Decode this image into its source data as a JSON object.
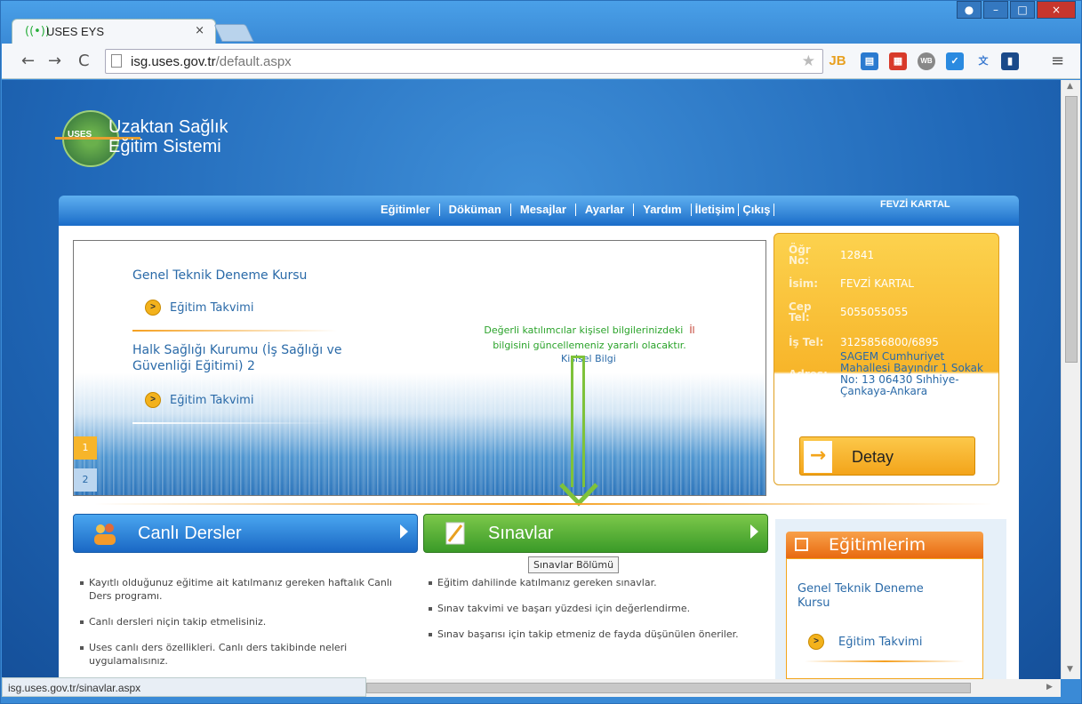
{
  "browser": {
    "tab_title": "USES EYS",
    "tab_close": "×",
    "url_host": "isg.uses.gov.tr",
    "url_path": "/default.aspx",
    "status_url": "isg.uses.gov.tr/sinavlar.aspx",
    "extensions": [
      "JB",
      "calendar-ext",
      "red-ext",
      "WB",
      "check-ext",
      "translate-ext",
      "chart-ext"
    ]
  },
  "logo": {
    "badge": "USES",
    "line1": "Uzaktan Sağlık",
    "line2": "Eğitim Sistemi"
  },
  "menu": {
    "items": [
      "Eğitimler",
      "Döküman",
      "Mesajlar",
      "Ayarlar",
      "Yardım",
      "İletişim",
      "Çıkış"
    ],
    "username": "FEVZİ KARTAL"
  },
  "banner": {
    "course1": "Genel Teknik Deneme Kursu",
    "course2_line1": "Halk Sağlığı Kurumu (İş Sağlığı ve",
    "course2_line2": "Güvenliği Eğitimi) 2",
    "takvim_label": "Eğitim Takvimi",
    "notice_line1": "Değerli katılımcılar kişisel bilgilerinizdeki",
    "notice_il": "İl",
    "notice_line2": "bilgisini güncellemeniz yararlı olacaktır.",
    "notice_link": "Kişisel Bilgi",
    "pages": [
      "1",
      "2"
    ]
  },
  "info": {
    "ogr_no_key1": "Öğr",
    "ogr_no_key2": "No:",
    "ogr_no": "12841",
    "isim_key": "İsim:",
    "isim": "FEVZİ KARTAL",
    "cep_key1": "Cep",
    "cep_key2": "Tel:",
    "cep": "5055055055",
    "is_tel_key": "İş Tel:",
    "is_tel": "3125856800/6895",
    "adres_key": "Adres:",
    "adres": [
      "SAGEM Cumhuriyet",
      "Mahallesi Bayındır 1 Sokak",
      "No: 13 06430 Sıhhiye-",
      "Çankaya-Ankara"
    ],
    "detay_label": "Detay"
  },
  "sections": {
    "canli": {
      "label": "Canlı Dersler",
      "bullets": [
        "Kayıtlı olduğunuz eğitime ait katılmanız gereken haftalık Canlı Ders programı.",
        "Canlı dersleri niçin takip etmelisiniz.",
        "Uses canlı ders özellikleri. Canlı ders takibinde neleri uygulamalısınız."
      ]
    },
    "sinav": {
      "label": "Sınavlar",
      "tooltip": "Sınavlar Bölümü",
      "bullets": [
        "Eğitim dahilinde katılmanız gereken sınavlar.",
        "Sınav takvimi ve başarı yüzdesi için değerlendirme.",
        "Sınav başarısı için takip etmeniz de fayda düşünülen öneriler."
      ]
    },
    "egitimlerim": {
      "label": "Eğitimlerim",
      "course_line1": "Genel Teknik Deneme",
      "course_line2": "Kursu",
      "takvim_label": "Eğitim Takvimi"
    }
  },
  "colors": {
    "accent_blue": "#2a6aa8",
    "accent_orange": "#f7b52a",
    "accent_green": "#5aa83a"
  }
}
